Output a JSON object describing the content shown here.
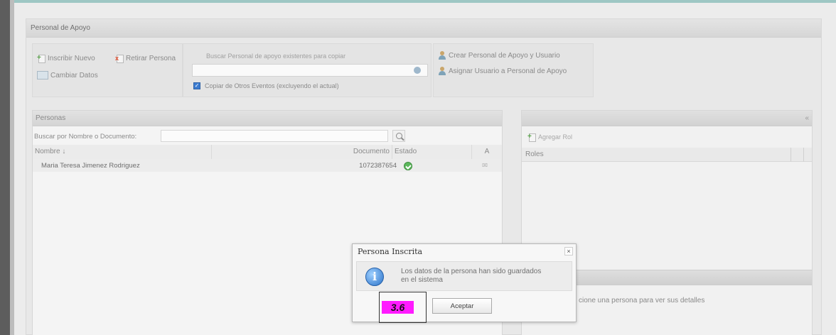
{
  "panel": {
    "title": "Personal de Apoyo"
  },
  "toolbar": {
    "inscribir_nuevo": "Inscribir Nuevo",
    "retirar_persona": "Retirar Persona",
    "cambiar_datos": "Cambiar Datos",
    "search_caption": "Buscar Personal de apoyo existentes para copiar",
    "search_value": "",
    "copy_checkbox_label": "Copiar de Otros Eventos (excluyendo el actual)",
    "copy_checked": true,
    "crear_personal": "Crear Personal de Apoyo y Usuario",
    "asignar_usuario": "Asignar Usuario a Personal de Apoyo"
  },
  "personas": {
    "title": "Personas",
    "filter_label": "Buscar por Nombre o Documento:",
    "filter_value": "",
    "columns": [
      "Nombre ↓",
      "Documento",
      "Estado",
      "A"
    ],
    "rows": [
      {
        "nombre": "Maria Teresa Jimenez Rodriguez",
        "documento": "1072387654",
        "estado": "activo",
        "a": "✉"
      }
    ]
  },
  "right_panel": {
    "toggle": "«",
    "add_rol": "Agregar Rol",
    "roles_header": "Roles",
    "hint": "cione una persona para ver sus detalles"
  },
  "dialog": {
    "title": "Persona Inscrita",
    "close": "×",
    "message": "Los datos de la persona han sido guardados en el sistema",
    "accept": "Aceptar",
    "info_icon": "info-icon"
  },
  "annotation": {
    "step": "3.6"
  },
  "colors": {
    "accent_line": "#9ec7c4",
    "step_tag": "#ff1aff",
    "status_ok": "#5cb85c"
  }
}
